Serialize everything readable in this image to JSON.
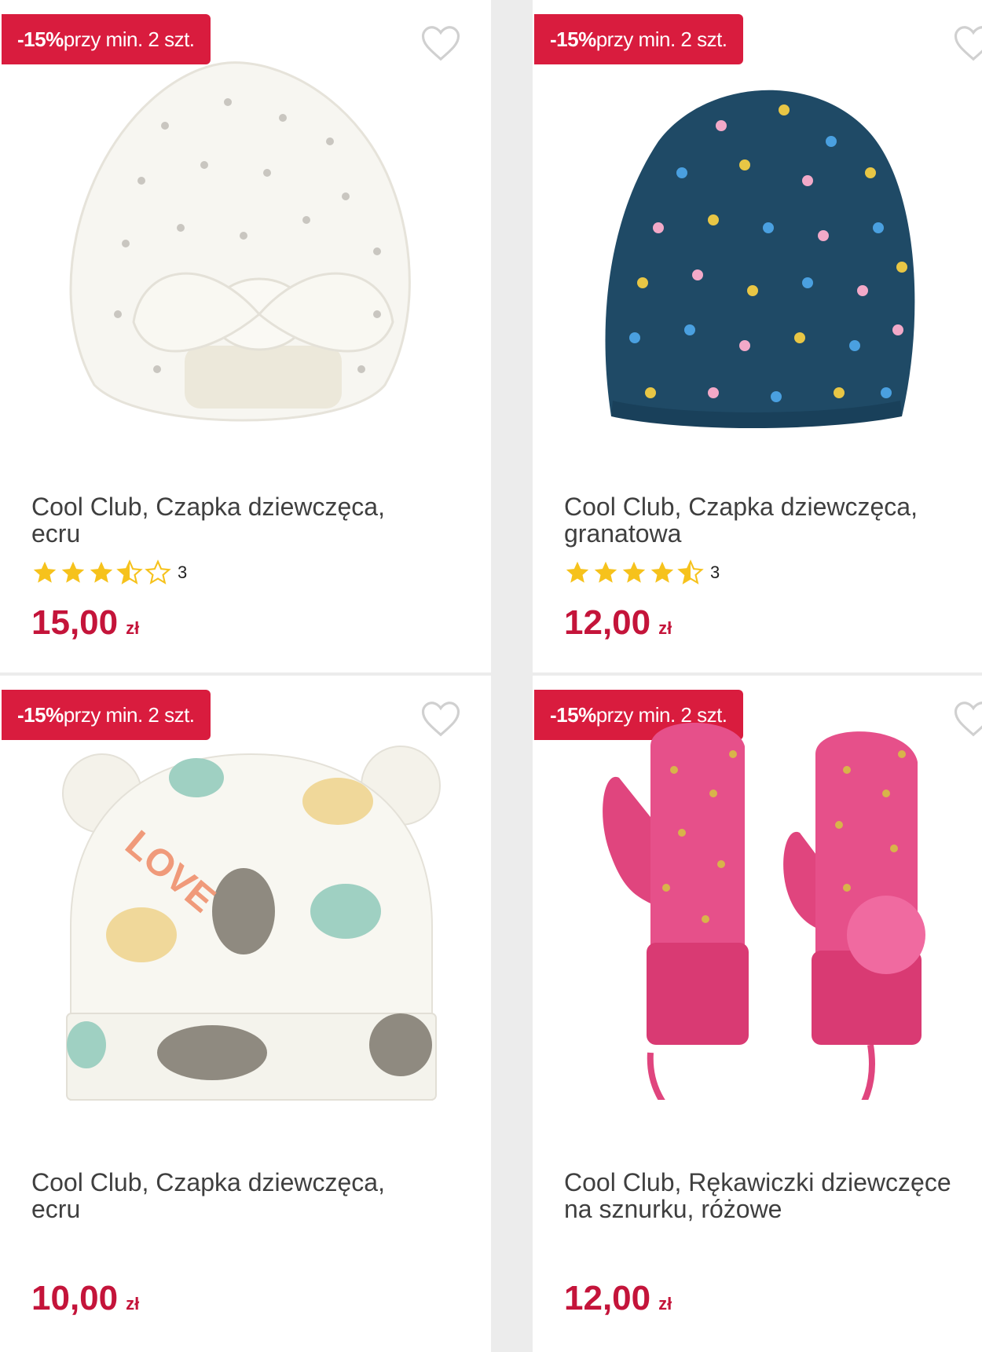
{
  "products": [
    {
      "badge_pct": "-15%",
      "badge_text": " przy min. 2 szt.",
      "title_line1": "Cool Club, Czapka dziewczęca,",
      "title_line2": "ecru",
      "rating": 3.5,
      "rating_count": "3",
      "price": "15,00",
      "currency": "zł",
      "image_icon": "white-turban-hat-image"
    },
    {
      "badge_pct": "-15%",
      "badge_text": " przy min. 2 szt.",
      "title_line1": "Cool Club, Czapka dziewczęca,",
      "title_line2": "granatowa",
      "rating": 4.5,
      "rating_count": "3",
      "price": "12,00",
      "currency": "zł",
      "image_icon": "navy-polka-dot-beanie-image"
    },
    {
      "badge_pct": "-15%",
      "badge_text": " przy min. 2 szt.",
      "title_line1": "Cool Club, Czapka dziewczęca,",
      "title_line2": "ecru",
      "price": "10,00",
      "currency": "zł",
      "image_icon": "tiger-print-hat-with-ears-image"
    },
    {
      "badge_pct": "-15%",
      "badge_text": " przy min. 2 szt.",
      "title_line1": "Cool Club, Rękawiczki dziewczęce",
      "title_line2": "na sznurku, różowe",
      "price": "12,00",
      "currency": "zł",
      "image_icon": "pink-mittens-on-string-image"
    }
  ],
  "colors": {
    "badge": "#d91c3e",
    "price": "#c4143a",
    "star": "#f6c21c"
  }
}
